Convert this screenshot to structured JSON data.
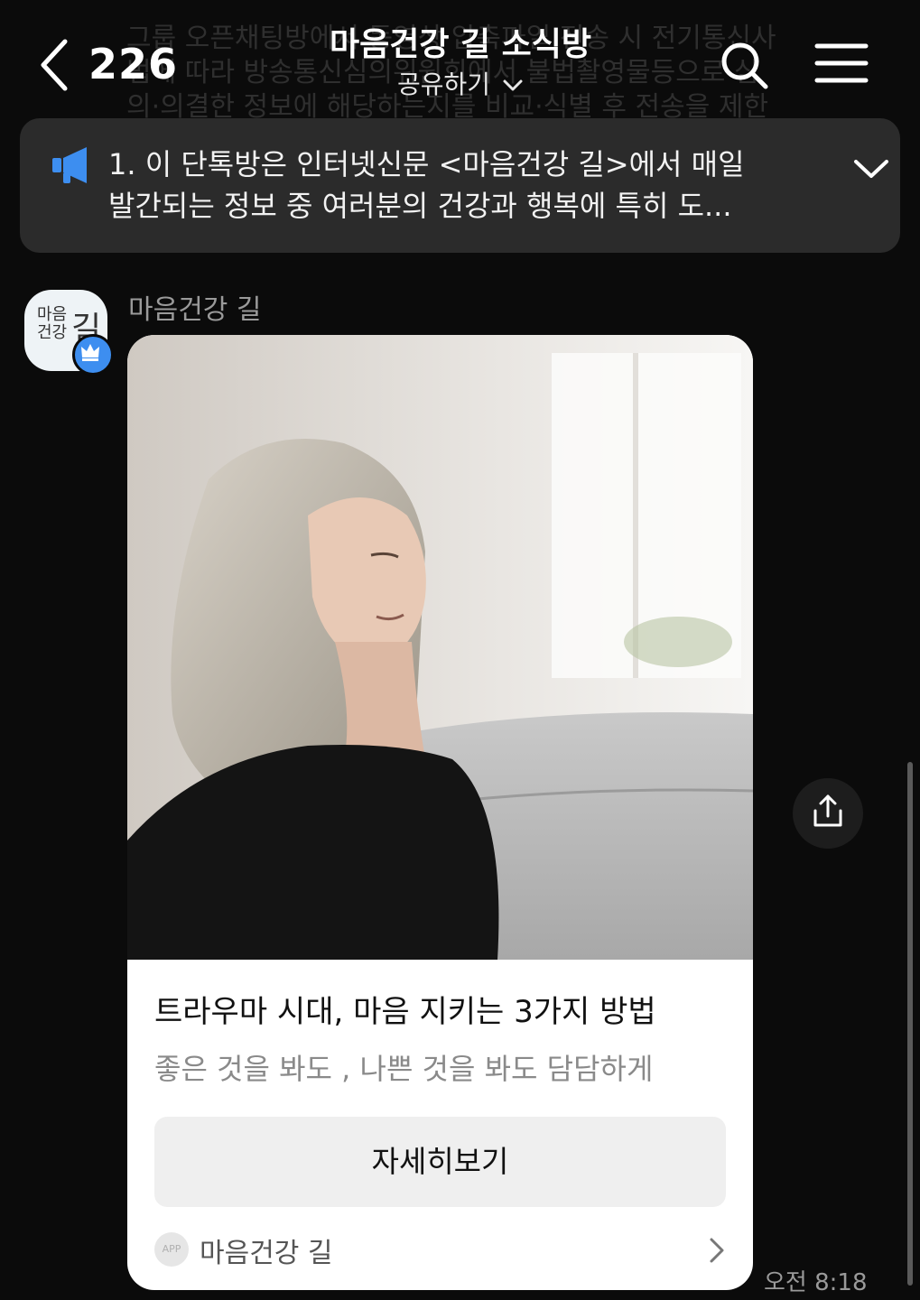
{
  "header": {
    "unread_count": "226",
    "title": "마음건강 길 소식방",
    "share_label": "공유하기"
  },
  "background_notice": {
    "lines": [
      "그룹 오픈채팅방에서 동영상·압축파일 전송 시 전기통신사",
      "법에 따라 방송통신심의위원회에서 불법촬영물등으로 심",
      "의·의결한 정보에 해당하는지를 비교·식별 후 전송을 제한"
    ]
  },
  "notice": {
    "line1": "1. 이 단톡방은 인터넷신문 <마음건강 길>에서 매일",
    "line2": "발간되는 정보 중 여러분의 건강과 행복에 특히 도..."
  },
  "message": {
    "sender": "마음건강 길",
    "avatar_text_small": "마음\n건강",
    "avatar_text_big": "길",
    "card": {
      "title": "트라우마 시대, 마음 지키는 3가지 방법",
      "description": "좋은 것을 봐도 , 나쁜 것을 봐도 담담하게",
      "button_label": "자세히보기",
      "app_badge": "APP",
      "footer_name": "마음건강 길"
    },
    "time": "오전 8:18"
  },
  "colors": {
    "background": "#0b0b0b",
    "notice_bg": "#2b2b2b",
    "accent_blue": "#3d8ef0",
    "card_bg": "#ffffff"
  },
  "icons": [
    "back-chevron-icon",
    "search-icon",
    "menu-icon",
    "megaphone-icon",
    "chevron-down-icon",
    "crown-icon",
    "share-icon",
    "chevron-right-icon"
  ]
}
